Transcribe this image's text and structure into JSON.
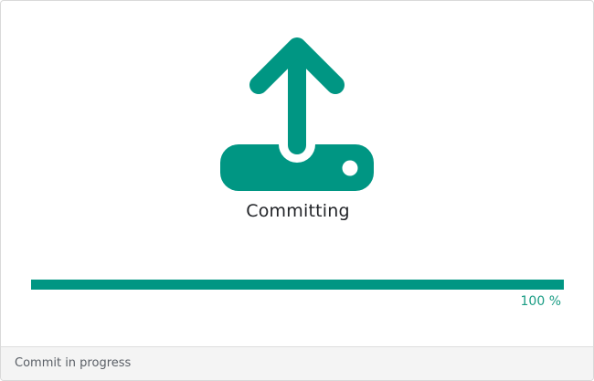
{
  "dialog": {
    "icon": "upload-to-drive-icon",
    "status_title": "Committing",
    "progress": {
      "percent": 100,
      "label": "100 %"
    },
    "footer_text": "Commit in progress"
  },
  "colors": {
    "accent": "#009683",
    "percent_text": "#1a9c84",
    "title_text": "#222428",
    "footer_bg": "#f4f4f4"
  }
}
